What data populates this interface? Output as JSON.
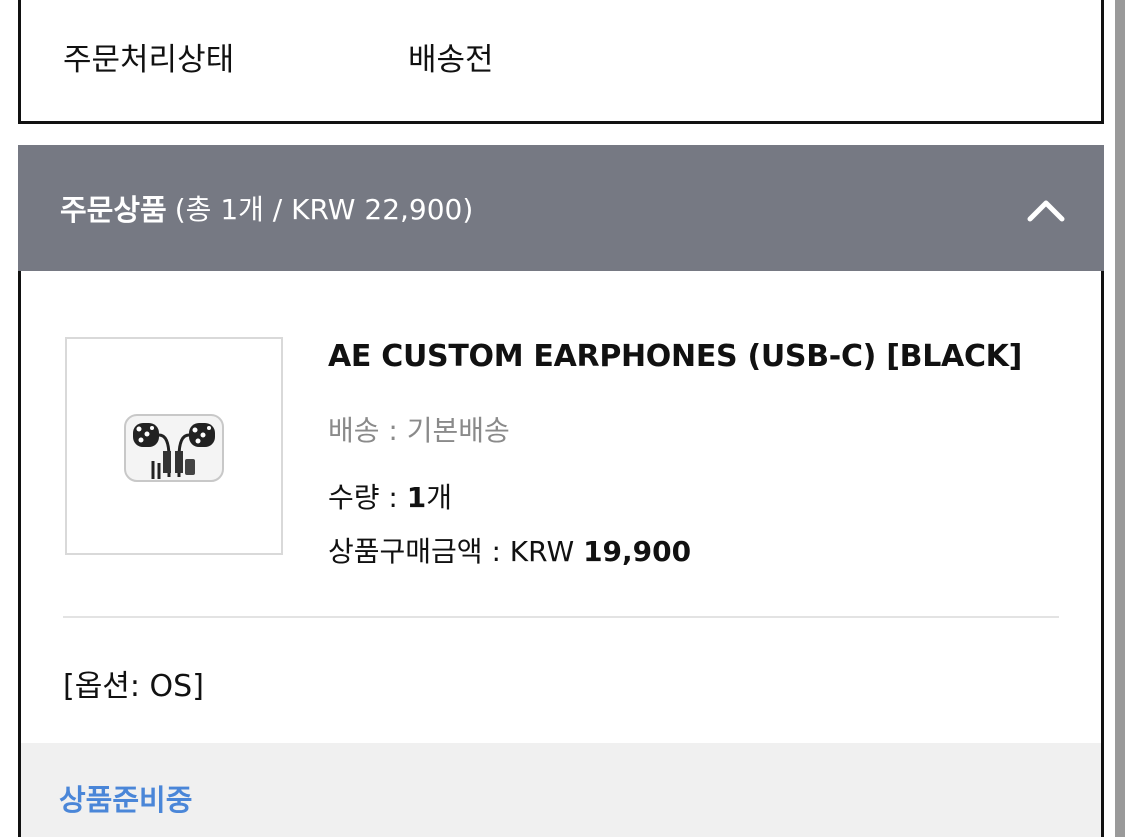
{
  "order_status": {
    "label": "주문처리상태",
    "value": "배송전"
  },
  "section": {
    "title": "주문상품",
    "summary": "(총 1개 / KRW 22,900)",
    "collapse_icon": "chevron-up-icon",
    "header_color": "#767983"
  },
  "product": {
    "name": "AE CUSTOM EARPHONES (USB-C) [BLACK]",
    "shipping_label": "배송 : ",
    "shipping_value": "기본배송",
    "qty_label": "수량 : ",
    "qty_value": "1",
    "qty_unit": "개",
    "price_label": "상품구매금액 : ",
    "price_currency": "KRW ",
    "price_value": "19,900",
    "option": "[옵션: OS]",
    "prep_status": "상품준비중",
    "prep_status_color": "#4a86d8"
  }
}
